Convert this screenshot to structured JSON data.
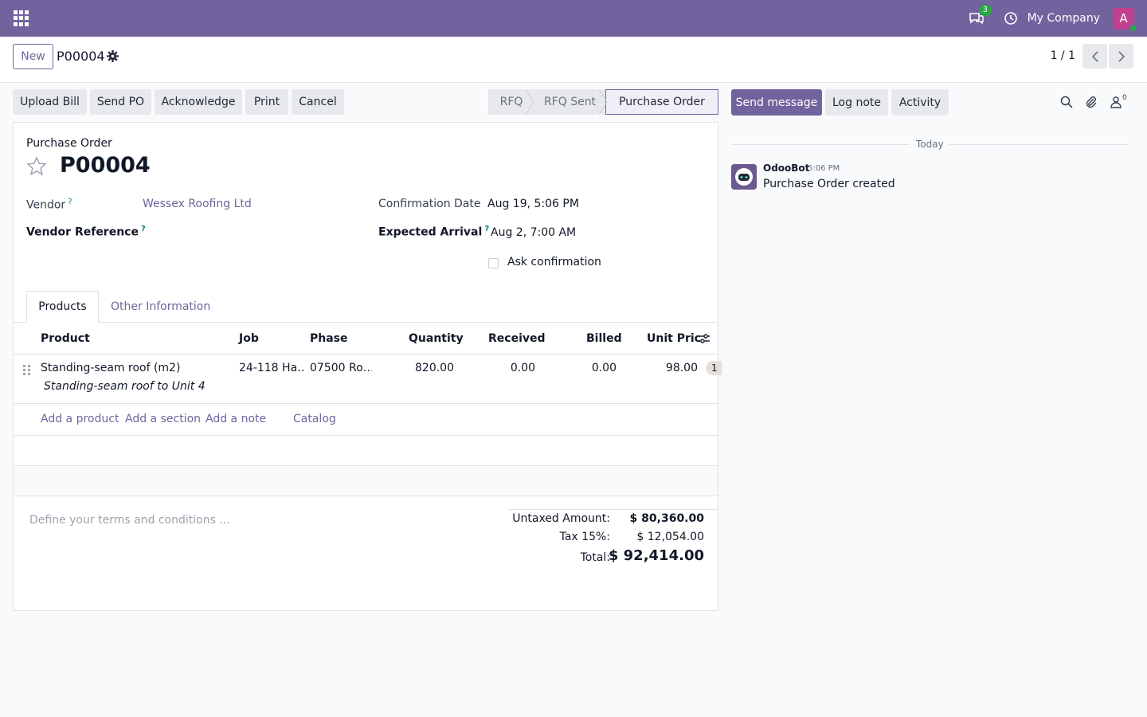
{
  "navbar": {
    "chat_badge": "3",
    "company": "My Company",
    "avatar_letter": "A",
    "brand_color": "#71639e"
  },
  "control": {
    "new_label": "New",
    "record_name": "P00004",
    "pager": "1 / 1"
  },
  "actions": {
    "upload_bill": "Upload Bill",
    "send_po": "Send PO",
    "acknowledge": "Acknowledge",
    "print": "Print",
    "cancel": "Cancel"
  },
  "status": {
    "stages": [
      "RFQ",
      "RFQ Sent",
      "Purchase Order"
    ],
    "active": "Purchase Order"
  },
  "form": {
    "po_label": "Purchase Order",
    "po_number": "P00004",
    "vendor_label": "Vendor",
    "vendor_value": "Wessex Roofing Ltd",
    "vendor_ref_label": "Vendor Reference",
    "confirmation_label": "Confirmation Date",
    "confirmation_value": "Aug 19, 5:06 PM",
    "expected_label": "Expected Arrival",
    "expected_value": "Aug 2, 7:00 AM",
    "ask_confirmation": "Ask confirmation",
    "help_mark": "?"
  },
  "tabs": {
    "products": "Products",
    "other": "Other Information"
  },
  "table": {
    "columns": [
      "Product",
      "Job",
      "Phase",
      "Quantity",
      "Received",
      "Billed",
      "Unit Pric"
    ],
    "row": {
      "product": "Standing-seam roof (m2)",
      "job": "24-118 Ha…",
      "phase": "07500 Ro…",
      "quantity": "820.00",
      "received": "0.00",
      "billed": "0.00",
      "unit_price": "98.00",
      "tax": "1",
      "description": "Standing-seam roof to Unit 4"
    },
    "add_product": "Add a product",
    "add_section": "Add a section",
    "add_note": "Add a note",
    "catalog": "Catalog"
  },
  "footer": {
    "terms_placeholder": "Define your terms and conditions ...",
    "untaxed_label": "Untaxed Amount:",
    "untaxed_value": "$ 80,360.00",
    "tax_label": "Tax 15%:",
    "tax_value": "$ 12,054.00",
    "total_label": "Total:",
    "total_value": "$ 92,414.00"
  },
  "chatter": {
    "send_message": "Send message",
    "log_note": "Log note",
    "activity": "Activity",
    "followers": "0",
    "today": "Today",
    "author": "OdooBot",
    "time": "5:06 PM",
    "message": "Purchase Order created"
  }
}
